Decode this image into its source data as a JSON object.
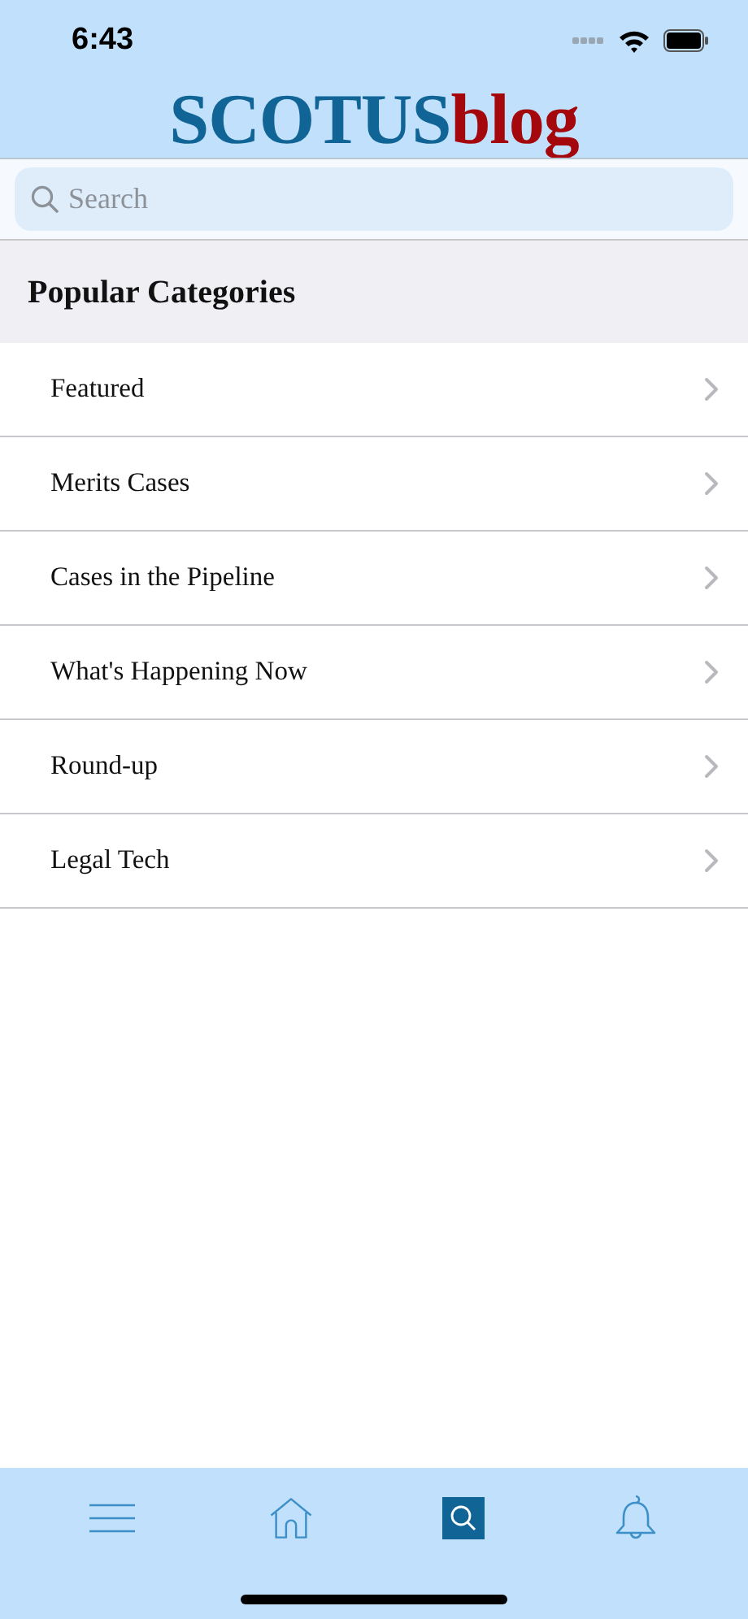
{
  "status_bar": {
    "time": "6:43"
  },
  "logo": {
    "main": "SCOTUS",
    "suffix": "blog"
  },
  "search": {
    "placeholder": "Search"
  },
  "section": {
    "title": "Popular Categories"
  },
  "categories": [
    {
      "label": "Featured"
    },
    {
      "label": "Merits Cases"
    },
    {
      "label": "Cases in the Pipeline"
    },
    {
      "label": "What's Happening Now"
    },
    {
      "label": "Round-up"
    },
    {
      "label": "Legal Tech"
    }
  ],
  "tab_bar": [
    {
      "kind": "menu",
      "selected": false
    },
    {
      "kind": "home",
      "selected": false
    },
    {
      "kind": "search",
      "selected": true
    },
    {
      "kind": "alerts",
      "selected": false
    }
  ]
}
